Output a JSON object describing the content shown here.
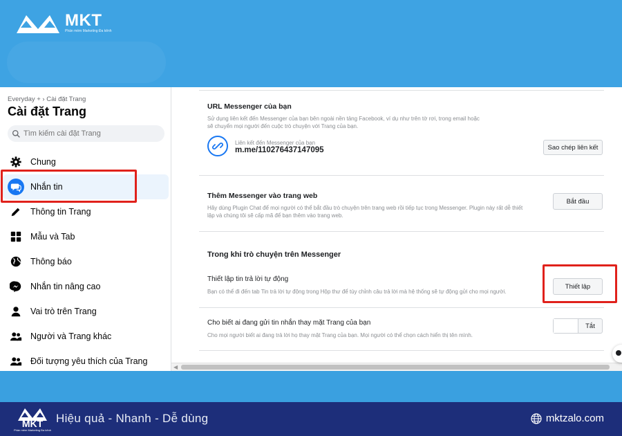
{
  "brand": {
    "name": "MKT",
    "tagline": "Phần mềm Marketing Đa kênh"
  },
  "sidebar": {
    "breadcrumb": "Everyday + › Cài đặt Trang",
    "title": "Cài đặt Trang",
    "search_placeholder": "Tìm kiếm cài đặt Trang",
    "items": [
      {
        "label": "Chung",
        "icon": "gear-icon"
      },
      {
        "label": "Nhắn tin",
        "icon": "chat-bubble-icon",
        "active": true
      },
      {
        "label": "Thông tin Trang",
        "icon": "pencil-icon"
      },
      {
        "label": "Mẫu và Tab",
        "icon": "grid-icon"
      },
      {
        "label": "Thông báo",
        "icon": "globe-icon"
      },
      {
        "label": "Nhắn tin nâng cao",
        "icon": "messenger-icon"
      },
      {
        "label": "Vai trò trên Trang",
        "icon": "person-icon"
      },
      {
        "label": "Người và Trang khác",
        "icon": "people-icon"
      },
      {
        "label": "Đối tượng yêu thích của Trang",
        "icon": "people-icon"
      }
    ]
  },
  "content": {
    "url_section": {
      "title": "URL Messenger của bạn",
      "desc1": "Sử dụng liên kết đến Messenger của bạn bên ngoài nền tảng Facebook, ví dụ như trên tờ rơi, trong email hoặc",
      "desc2": "sẽ chuyển mọi người đến cuộc trò chuyện với Trang của bạn.",
      "link_label": "Liên kết đến Messenger của bạn",
      "link_value": "m.me/110276437147095",
      "copy_button": "Sao chép liên kết"
    },
    "website_section": {
      "title": "Thêm Messenger vào trang web",
      "desc1": "Hãy dùng Plugin Chat để mọi người có thể bắt đầu trò chuyện trên trang web rồi tiếp tục trong Messenger. Plugin này rất dễ thiết",
      "desc2": "lập và chúng tôi sẽ cấp mã để bạn thêm vào trang web.",
      "button": "Bắt đầu"
    },
    "during_chat": {
      "heading": "Trong khi trò chuyện trên Messenger",
      "auto_reply_title": "Thiết lập tin trả lời tự động",
      "auto_reply_desc": "Bạn có thể đi đến tab Tin trả lời tự động trong Hộp thư để tùy chỉnh câu trả lời mà hệ thống sẽ tự động gửi cho mọi người.",
      "auto_reply_button": "Thiết lập",
      "sender_title": "Cho biết ai đang gửi tin nhắn thay mặt Trang của bạn",
      "sender_desc": "Cho mọi người biết ai đang trả lời họ thay mặt Trang của bạn. Mọi người có thể chọn cách hiển thị tên mình.",
      "toggle_label": "Tắt"
    }
  },
  "footer": {
    "slogan": "Hiệu quả - Nhanh  - Dễ dùng",
    "website": "mktzalo.com"
  },
  "colors": {
    "background": "#3ea3e3",
    "footer": "#1d2e7a",
    "accent": "#1877f2",
    "highlight": "#e0211b"
  }
}
